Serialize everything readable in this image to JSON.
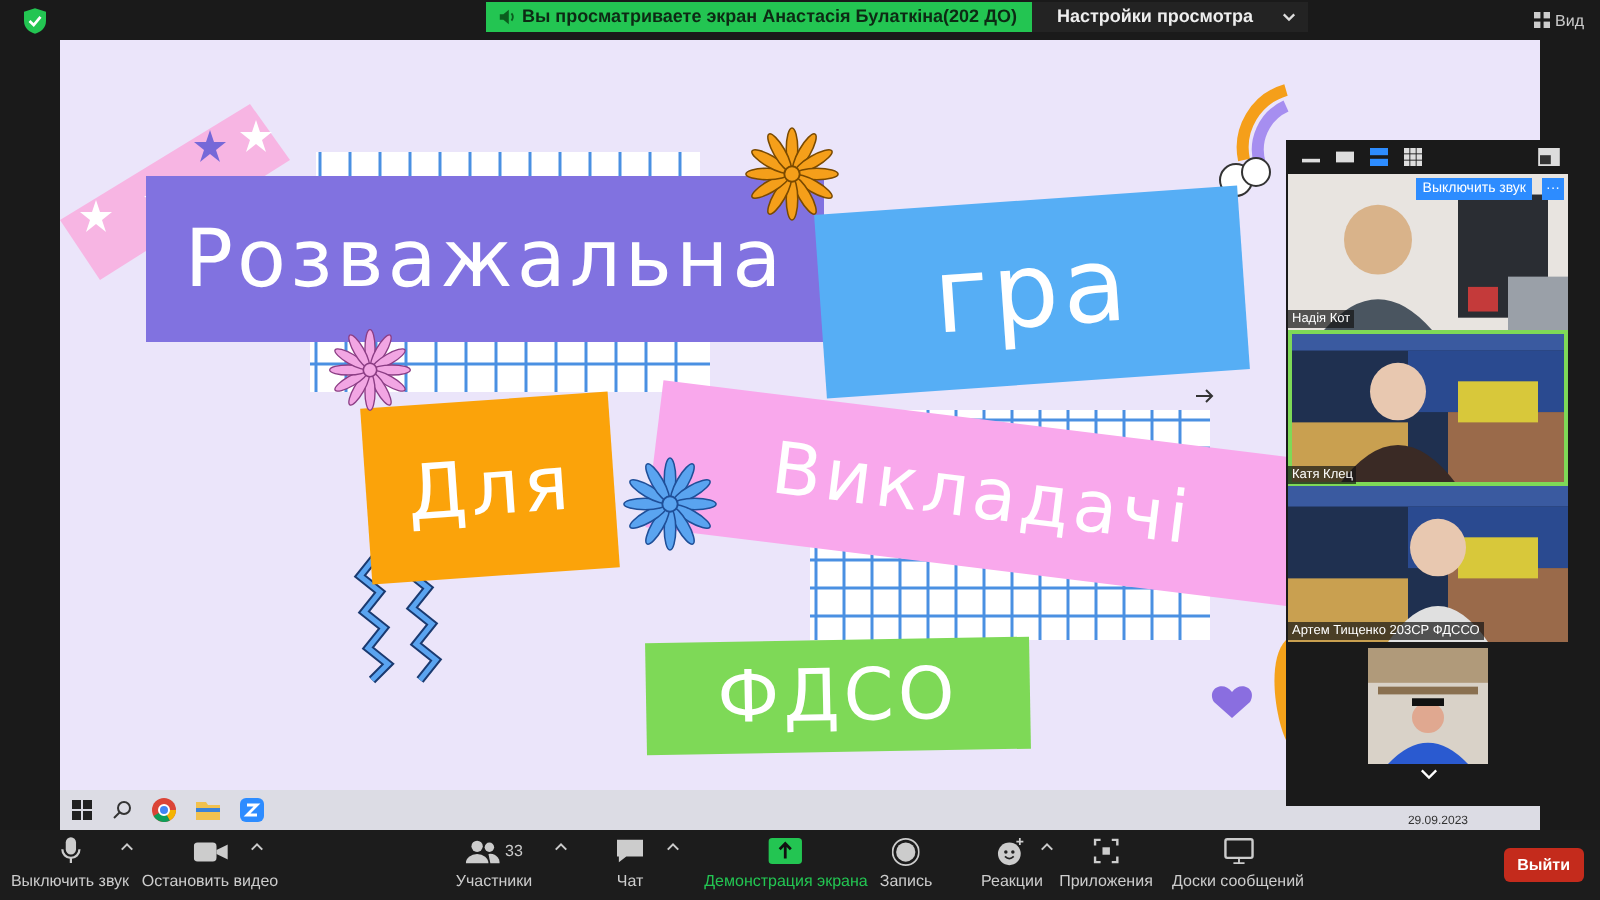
{
  "top_bar": {
    "banner": "Вы просматриваете экран Анастасія Булаткіна(202 ДО)",
    "view_options": "Настройки просмотра",
    "view_button": "Вид"
  },
  "slide": {
    "words": [
      {
        "text": "Розважальна",
        "color": "#8172e0"
      },
      {
        "text": "гра",
        "color": "#56aef5"
      },
      {
        "text": "Для",
        "color": "#fba30a"
      },
      {
        "text": "Викладачі",
        "color": "#f9a8ec"
      },
      {
        "text": "ФДСО",
        "color": "#7ed957"
      }
    ]
  },
  "taskbar": {
    "date": "29.09.2023"
  },
  "video_panel": {
    "layout_buttons": [
      {
        "selected": false
      },
      {
        "selected": false
      },
      {
        "selected": true
      },
      {
        "selected": false
      }
    ],
    "mute_button": "Выключить звук",
    "more_button": "···",
    "tiles": [
      {
        "kind": "full",
        "name": "Надія Кот",
        "speaking": false
      },
      {
        "kind": "full",
        "name": "Катя Клец",
        "speaking": true
      },
      {
        "kind": "full",
        "name": "Артем Тищенко 203СР ФДССО",
        "speaking": false
      },
      {
        "kind": "inset",
        "speaking": false
      }
    ]
  },
  "toolbar": {
    "items": [
      {
        "kind": "mic",
        "label": "Выключить звук",
        "caret": true
      },
      {
        "kind": "video",
        "label": "Остановить видео",
        "caret": true
      },
      {
        "kind": "participants",
        "label": "Участники",
        "count": "33",
        "caret": true
      },
      {
        "kind": "chat",
        "label": "Чат",
        "caret": true
      },
      {
        "kind": "share",
        "label": "Демонстрация экрана",
        "caret": false
      },
      {
        "kind": "record",
        "label": "Запись",
        "caret": false
      },
      {
        "kind": "reactions",
        "label": "Реакции",
        "caret": true
      },
      {
        "kind": "apps",
        "label": "Приложения",
        "caret": false
      },
      {
        "kind": "whiteboards",
        "label": "Доски сообщений",
        "caret": false
      }
    ],
    "leave_button": "Выйти"
  }
}
